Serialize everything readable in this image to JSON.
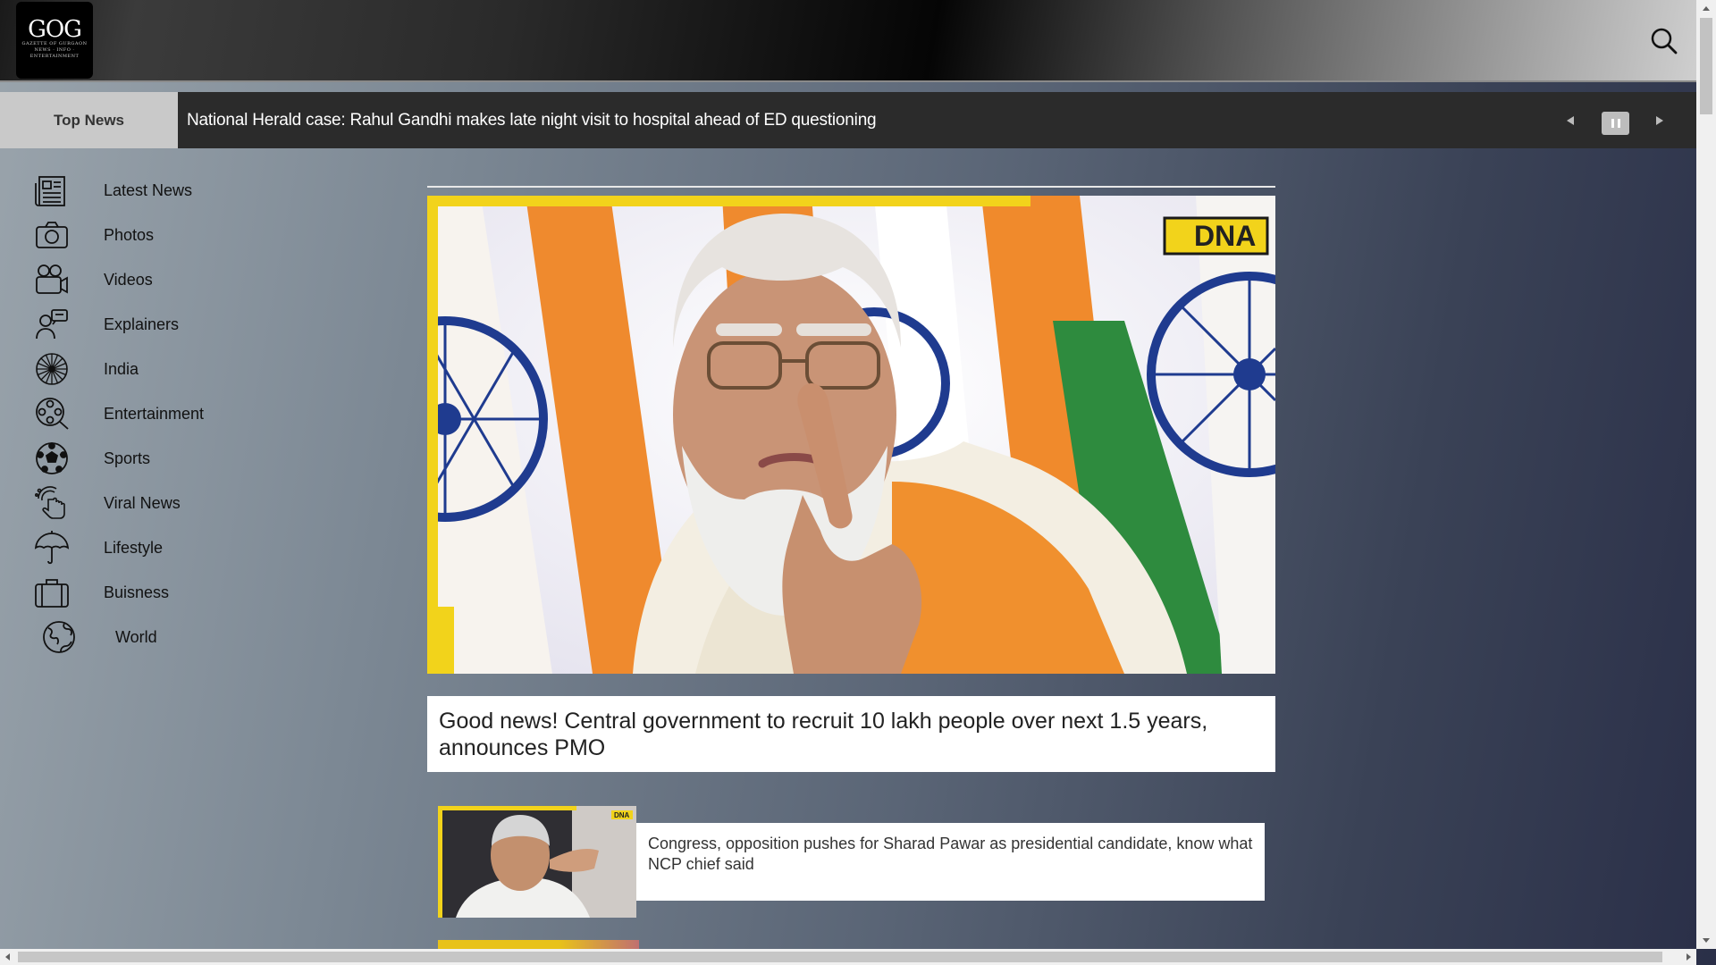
{
  "header": {
    "logo_mark": "GOG",
    "logo_tagline": "GAZETTE OF GURGAON",
    "logo_subtag": "NEWS · INFO · ENTERTAINMENT"
  },
  "ticker": {
    "label": "Top News",
    "headline": "National Herald case: Rahul Gandhi makes late night visit to hospital ahead of ED questioning"
  },
  "sidebar": {
    "items": [
      {
        "label": "Latest News",
        "icon": "newspaper-icon"
      },
      {
        "label": "Photos",
        "icon": "camera-icon"
      },
      {
        "label": "Videos",
        "icon": "video-camera-icon"
      },
      {
        "label": "Explainers",
        "icon": "presenter-icon"
      },
      {
        "label": "India",
        "icon": "ashoka-chakra-icon"
      },
      {
        "label": "Entertainment",
        "icon": "film-reel-icon"
      },
      {
        "label": "Sports",
        "icon": "football-icon"
      },
      {
        "label": "Viral News",
        "icon": "touch-viral-icon"
      },
      {
        "label": "Lifestyle",
        "icon": "umbrella-icon"
      },
      {
        "label": "Buisness",
        "icon": "briefcase-icon"
      },
      {
        "label": "World",
        "icon": "globe-icon"
      }
    ]
  },
  "main": {
    "hero": {
      "badge": "DNA",
      "caption": "Good news! Central government to recruit 10 lakh people over next 1.5 years, announces PMO"
    },
    "cards": [
      {
        "badge": "DNA",
        "caption": "Congress, opposition pushes for Sharad Pawar as presidential candidate, know what NCP chief said"
      }
    ]
  },
  "colors": {
    "accent_yellow": "#f2d31b",
    "ticker_bg": "#2b2b2b",
    "ticker_label_bg": "#c9c9c9",
    "flag_saffron": "#f08a2c",
    "flag_green": "#2e8b3e",
    "chakra_blue": "#1f3b8f"
  }
}
